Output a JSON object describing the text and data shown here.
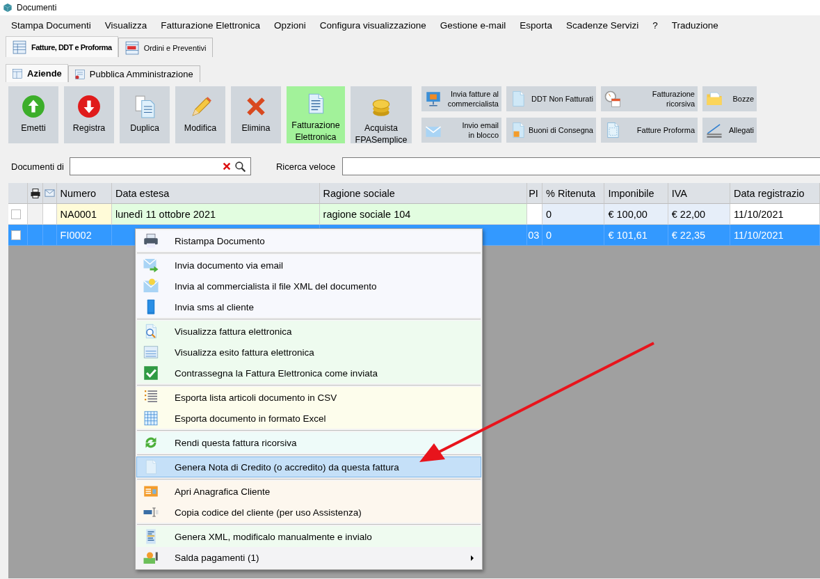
{
  "window": {
    "title": "Documenti"
  },
  "menu": [
    "Stampa Documenti",
    "Visualizza",
    "Fatturazione Elettronica",
    "Opzioni",
    "Configura visualizzazione",
    "Gestione e-mail",
    "Esporta",
    "Scadenze Servizi",
    "?",
    "Traduzione"
  ],
  "tabs": [
    {
      "label": "Fatture, DDT e Proforma",
      "selected": true
    },
    {
      "label": "Ordini e Preventivi",
      "selected": false
    }
  ],
  "subtabs": [
    {
      "label": "Aziende",
      "selected": true
    },
    {
      "label": "Pubblica Amministrazione",
      "selected": false
    }
  ],
  "toolbar": {
    "large": [
      {
        "label": "Emetti",
        "highlighted": false
      },
      {
        "label": "Registra",
        "highlighted": false
      },
      {
        "label": "Duplica",
        "highlighted": false
      },
      {
        "label": "Modifica",
        "highlighted": false
      },
      {
        "label": "Elimina",
        "highlighted": false
      },
      {
        "label": "Fatturazione\nElettronica",
        "highlighted": true
      },
      {
        "label": "Acquista\nFPASemplice",
        "highlighted": false
      }
    ],
    "small": [
      "Invia fatture al\ncommercialista",
      "DDT Non Fatturati",
      "Fatturazione ricorsiva",
      "Bozze",
      "Invio email\nin blocco",
      "Buoni di Consegna",
      "Fatture Proforma",
      "Allegati"
    ]
  },
  "search": {
    "documenti_di": "Documenti di",
    "ricerca_veloce": "Ricerca veloce"
  },
  "table": {
    "columns": [
      "Numero",
      "Data estesa",
      "Ragione sociale",
      "PI",
      "% Ritenuta",
      "Imponibile",
      "IVA",
      "Data registrazio"
    ],
    "rows": [
      {
        "selected": false,
        "checked": false,
        "cells": [
          "NA0001",
          "lunedì 11 ottobre 2021",
          "ragione sociale 104",
          "",
          "0",
          "€ 100,00",
          "€ 22,00",
          "11/10/2021"
        ]
      },
      {
        "selected": true,
        "checked": false,
        "cells": [
          "FI0002",
          null,
          null,
          "03",
          "0",
          "€ 101,61",
          "€ 22,35",
          "11/10/2021"
        ]
      }
    ]
  },
  "context_menu": {
    "groups": [
      {
        "items": [
          {
            "label": "Ristampa Documento",
            "color": "#f7f8fd",
            "selected": false,
            "submenu": false
          }
        ]
      },
      {
        "items": [
          {
            "label": "Invia documento via email",
            "color": "#f7f8fd",
            "selected": false,
            "submenu": false
          },
          {
            "label": "Invia al commercialista il file XML del documento",
            "color": "#f7f8fd",
            "selected": false,
            "submenu": false
          },
          {
            "label": "Invia sms al cliente",
            "color": "#f7f8fd",
            "selected": false,
            "submenu": false
          }
        ]
      },
      {
        "items": [
          {
            "label": "Visualizza fattura elettronica",
            "color": "#eefbef",
            "selected": false,
            "submenu": false
          },
          {
            "label": "Visualizza esito fattura elettronica",
            "color": "#eefbef",
            "selected": false,
            "submenu": false
          },
          {
            "label": "Contrassegna la Fattura Elettronica come inviata",
            "color": "#eefbef",
            "selected": false,
            "submenu": false
          }
        ]
      },
      {
        "items": [
          {
            "label": "Esporta lista articoli documento in CSV",
            "color": "#fdfdec",
            "selected": false,
            "submenu": false
          },
          {
            "label": "Esporta documento in formato Excel",
            "color": "#fdfdec",
            "selected": false,
            "submenu": false
          }
        ]
      },
      {
        "items": [
          {
            "label": "Rendi questa fattura ricorsiva",
            "color": "#eefbf9",
            "selected": false,
            "submenu": false
          }
        ]
      },
      {
        "items": [
          {
            "label": "Genera Nota di Credito (o accredito) da questa fattura",
            "color": "#c5e0f8",
            "selected": true,
            "submenu": false
          }
        ]
      },
      {
        "items": [
          {
            "label": "Apri Anagrafica Cliente",
            "color": "#fdf7ee",
            "selected": false,
            "submenu": false
          },
          {
            "label": "Copia codice del cliente (per uso Assistenza)",
            "color": "#fdf7ee",
            "selected": false,
            "submenu": false
          }
        ]
      },
      {
        "items": [
          {
            "label": "Genera XML, modificalo manualmente e invialo",
            "color": "#effbf0",
            "selected": false,
            "submenu": false
          },
          {
            "label": "Salda pagamenti (1)",
            "color": "#f3f3f5",
            "selected": false,
            "submenu": true
          }
        ]
      }
    ]
  }
}
